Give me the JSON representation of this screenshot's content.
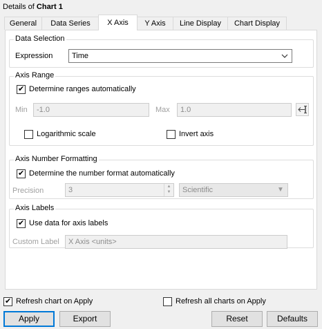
{
  "header": {
    "prefix": "Details of",
    "chart_name": "Chart 1"
  },
  "tabs": [
    {
      "label": "General"
    },
    {
      "label": "Data Series"
    },
    {
      "label": "X Axis"
    },
    {
      "label": "Y Axis"
    },
    {
      "label": "Line Display"
    },
    {
      "label": "Chart Display"
    }
  ],
  "active_tab": "X Axis",
  "data_selection": {
    "title": "Data Selection",
    "expression_label": "Expression",
    "expression_value": "Time"
  },
  "axis_range": {
    "title": "Axis Range",
    "auto_label": "Determine ranges automatically",
    "auto_checked": true,
    "min_label": "Min",
    "min_value": "-1.0",
    "max_label": "Max",
    "max_value": "1.0",
    "log_label": "Logarithmic scale",
    "log_checked": false,
    "invert_label": "Invert axis",
    "invert_checked": false
  },
  "number_format": {
    "title": "Axis Number Formatting",
    "auto_label": "Determine the number format automatically",
    "auto_checked": true,
    "precision_label": "Precision",
    "precision_value": "3",
    "format_value": "Scientific"
  },
  "axis_labels": {
    "title": "Axis Labels",
    "use_data_label": "Use data for axis labels",
    "use_data_checked": true,
    "custom_label": "Custom Label",
    "custom_value": "X Axis <units>"
  },
  "footer": {
    "refresh_apply_label": "Refresh chart on Apply",
    "refresh_apply_checked": true,
    "refresh_all_label": "Refresh all charts on Apply",
    "refresh_all_checked": false,
    "apply": "Apply",
    "export": "Export",
    "reset": "Reset",
    "defaults": "Defaults"
  },
  "icons": {
    "dropdown": "chevron-down-icon",
    "range_button": "fit-range-icon",
    "spinner": "spinner-arrows-icon"
  }
}
